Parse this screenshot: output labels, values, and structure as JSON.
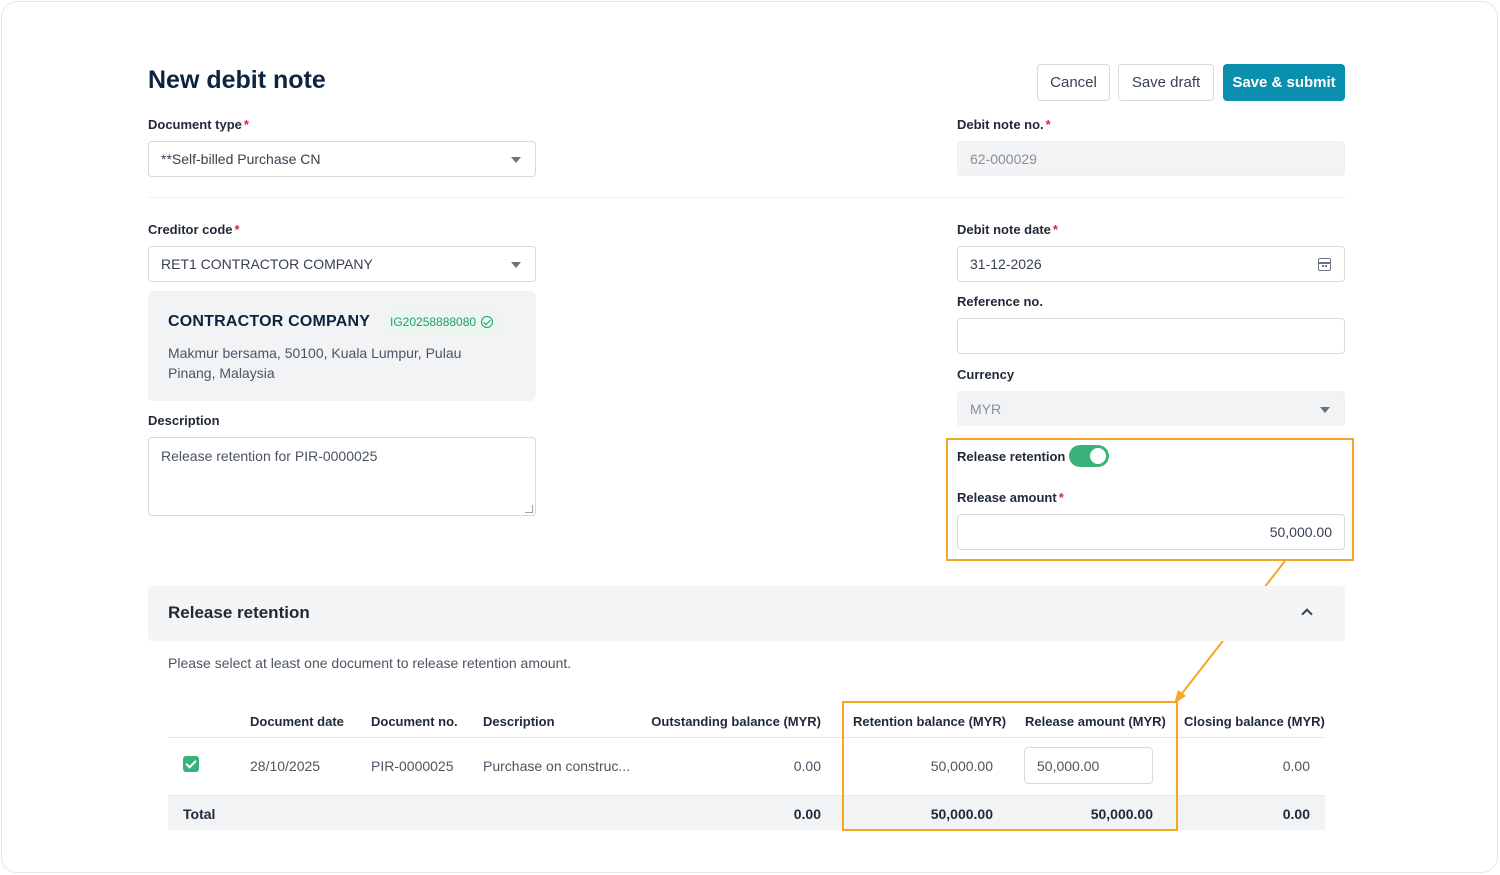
{
  "page": {
    "title": "New debit note"
  },
  "actions": {
    "cancel": "Cancel",
    "save_draft": "Save draft",
    "save_submit": "Save & submit"
  },
  "form": {
    "document_type": {
      "label": "Document type",
      "required": "*",
      "value": "**Self-billed Purchase CN"
    },
    "debit_note_no": {
      "label": "Debit note no.",
      "required": "*",
      "value": "62-000029"
    },
    "creditor_code": {
      "label": "Creditor code",
      "required": "*",
      "value": "RET1 CONTRACTOR COMPANY"
    },
    "creditor_card": {
      "name": "CONTRACTOR COMPANY",
      "tax_id": "IG20258888080",
      "address": "Makmur bersama, 50100, Kuala Lumpur, Pulau Pinang, Malaysia"
    },
    "debit_note_date": {
      "label": "Debit note date",
      "required": "*",
      "value": "31-12-2026"
    },
    "reference_no": {
      "label": "Reference no.",
      "value": ""
    },
    "currency": {
      "label": "Currency",
      "value": "MYR"
    },
    "description": {
      "label": "Description",
      "value": "Release retention for PIR-0000025"
    },
    "release_retention": {
      "label": "Release retention",
      "enabled": true
    },
    "release_amount": {
      "label": "Release amount",
      "required": "*",
      "value": "50,000.00"
    }
  },
  "section": {
    "title": "Release retention",
    "hint": "Please select at least one document to release retention amount.",
    "columns": [
      "Document date",
      "Document no.",
      "Description",
      "Outstanding balance (MYR)",
      "Retention balance (MYR)",
      "Release amount (MYR)",
      "Closing balance (MYR)"
    ],
    "rows": [
      {
        "checked": true,
        "document_date": "28/10/2025",
        "document_no": "PIR-0000025",
        "description": "Purchase on construc...",
        "outstanding": "0.00",
        "retention": "50,000.00",
        "release": "50,000.00",
        "closing": "0.00"
      }
    ],
    "total": {
      "label": "Total",
      "outstanding": "0.00",
      "retention": "50,000.00",
      "release": "50,000.00",
      "closing": "0.00"
    }
  },
  "colors": {
    "primary": "#0a8fae",
    "toggle_on": "#3ab37a",
    "highlight": "#f5a623",
    "required": "#e11d48"
  }
}
